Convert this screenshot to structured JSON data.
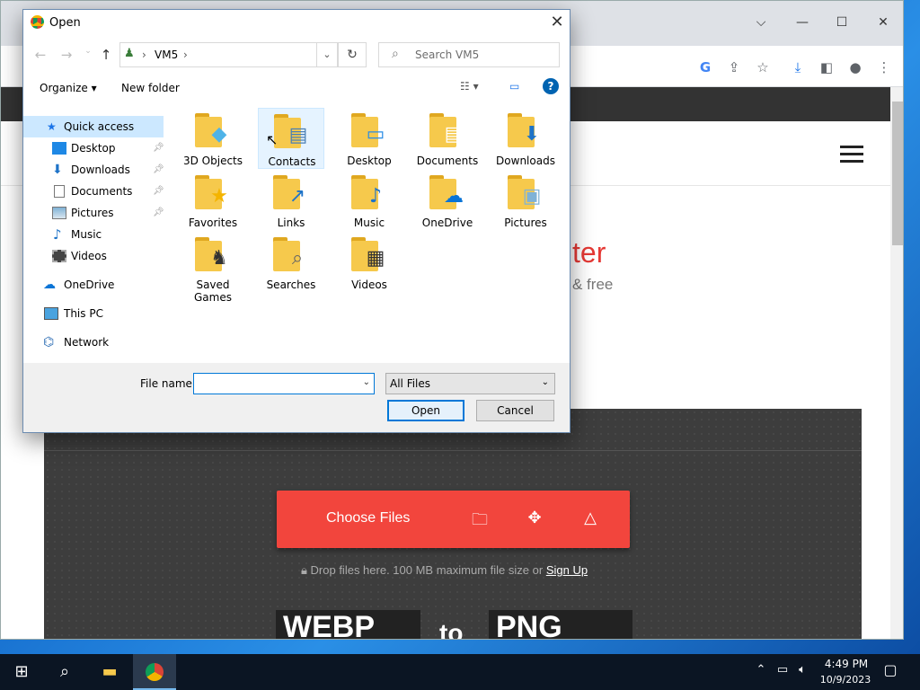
{
  "dialog": {
    "title": "Open",
    "address": {
      "segment": "VM5",
      "sep": "›"
    },
    "search_placeholder": "Search VM5",
    "toolbar": {
      "organize": "Organize ▾",
      "new_folder": "New folder"
    },
    "sidebar": [
      {
        "label": "Quick access",
        "icon": "star-icon"
      },
      {
        "label": "Desktop",
        "icon": "desktop-icon",
        "pinned": true
      },
      {
        "label": "Downloads",
        "icon": "download-arrow-icon",
        "pinned": true
      },
      {
        "label": "Documents",
        "icon": "document-icon",
        "pinned": true
      },
      {
        "label": "Pictures",
        "icon": "picture-icon",
        "pinned": true
      },
      {
        "label": "Music",
        "icon": "music-note-icon"
      },
      {
        "label": "Videos",
        "icon": "film-icon"
      },
      {
        "label": "OneDrive",
        "icon": "cloud-icon"
      },
      {
        "label": "This PC",
        "icon": "computer-icon"
      },
      {
        "label": "Network",
        "icon": "network-icon"
      }
    ],
    "files": [
      {
        "name": "3D Objects"
      },
      {
        "name": "Contacts"
      },
      {
        "name": "Desktop"
      },
      {
        "name": "Documents"
      },
      {
        "name": "Downloads"
      },
      {
        "name": "Favorites"
      },
      {
        "name": "Links"
      },
      {
        "name": "Music"
      },
      {
        "name": "OneDrive"
      },
      {
        "name": "Pictures"
      },
      {
        "name": "Saved Games"
      },
      {
        "name": "Searches"
      },
      {
        "name": "Videos"
      }
    ],
    "file_name_label": "File name:",
    "file_name_value": "",
    "file_type": "All Files",
    "open_label": "Open",
    "cancel_label": "Cancel"
  },
  "page": {
    "hero_title_fragment": "ter",
    "hero_sub_fragment": "& free",
    "choose_files": "Choose Files",
    "drop_text": "Drop files here. 100 MB maximum file size or",
    "sign_up": "Sign Up",
    "format_from": "WEBP",
    "format_to_word": "to",
    "format_to": "PNG"
  },
  "taskbar": {
    "time": "4:49 PM",
    "date": "10/9/2023"
  },
  "colors": {
    "accent": "#0078d7",
    "brand_red": "#f2453d",
    "folder": "#f6c94c"
  }
}
